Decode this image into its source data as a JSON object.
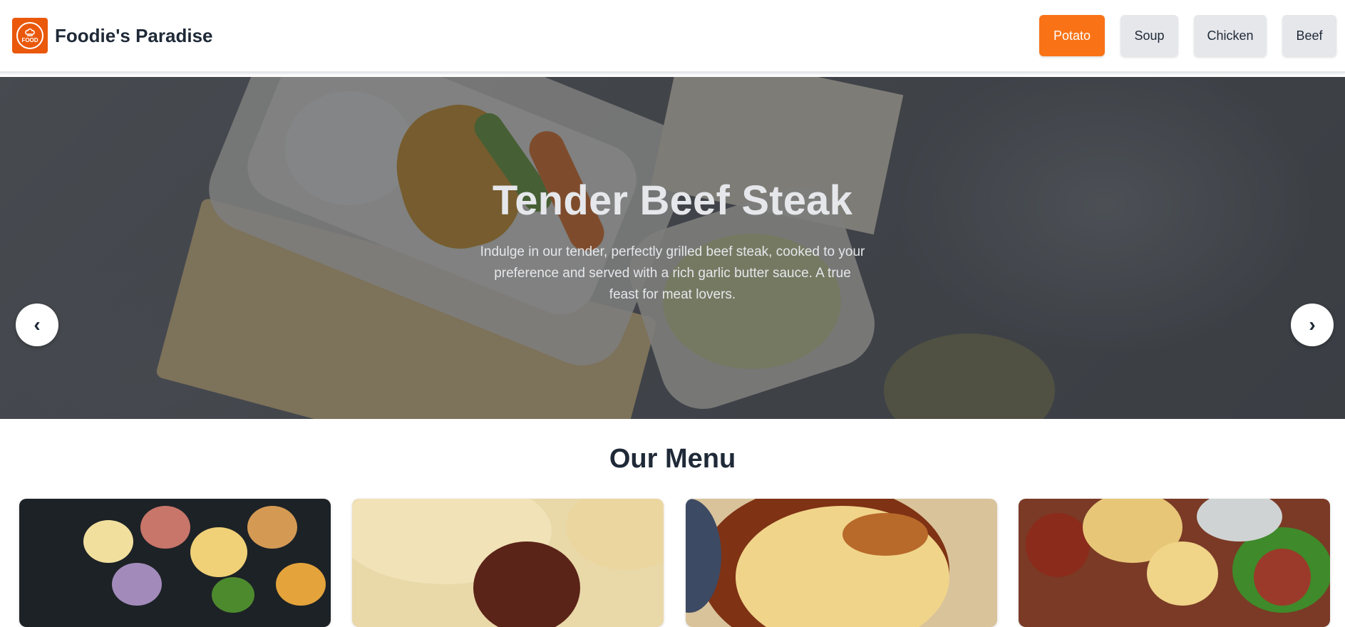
{
  "header": {
    "logo_text": "FOOD",
    "brand_name": "Foodie's Paradise",
    "nav": [
      {
        "label": "Potato",
        "active": true
      },
      {
        "label": "Soup",
        "active": false
      },
      {
        "label": "Chicken",
        "active": false
      },
      {
        "label": "Beef",
        "active": false
      }
    ]
  },
  "hero": {
    "title": "Tender Beef Steak",
    "description": "Indulge in our tender, perfectly grilled beef steak, cooked to your preference and served with a rich garlic butter sauce. A true feast for meat lovers.",
    "prev_label": "‹",
    "next_label": "›"
  },
  "menu": {
    "title": "Our Menu",
    "items": [
      {
        "image": "potato-hash-image"
      },
      {
        "image": "meat-pie-image"
      },
      {
        "image": "potato-gratin-image"
      },
      {
        "image": "sausage-potato-bake-image"
      }
    ]
  },
  "colors": {
    "accent": "#f97316",
    "logo": "#ea580c",
    "nav_inactive": "#e5e7eb",
    "text_dark": "#1f2937"
  }
}
